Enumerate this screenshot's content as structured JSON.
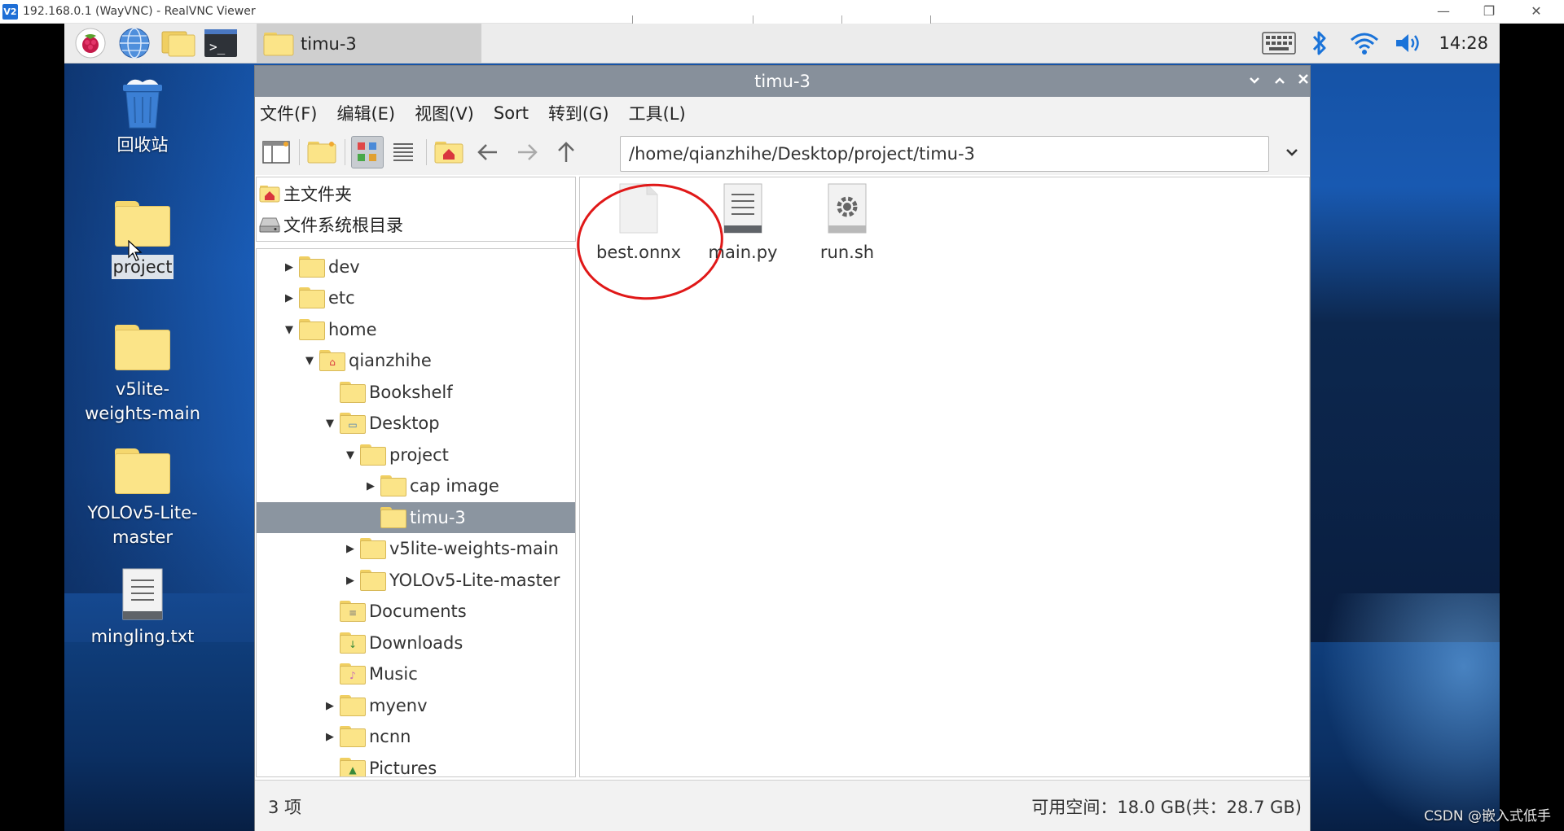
{
  "vnc": {
    "title": "192.168.0.1 (WayVNC) - RealVNC Viewer",
    "logo": "V2",
    "controls": {
      "minimize": "—",
      "restore": "❐",
      "close": "✕"
    }
  },
  "taskbar": {
    "launchers": [
      "raspberry-icon",
      "browser-globe-icon",
      "file-manager-icon",
      "terminal-icon"
    ],
    "task_label": "timu-3",
    "clock": "14:28"
  },
  "desktop": {
    "icons": [
      {
        "label": "回收站"
      },
      {
        "label": "project"
      },
      {
        "label": "v5lite-weights-main"
      },
      {
        "label": "YOLOv5-Lite-master"
      },
      {
        "label": "mingling.txt"
      }
    ]
  },
  "file_manager": {
    "title": "timu-3",
    "menu": [
      "文件(F)",
      "编辑(E)",
      "视图(V)",
      "Sort",
      "转到(G)",
      "工具(L)"
    ],
    "path": "/home/qianzhihe/Desktop/project/timu-3",
    "places": [
      "主文件夹",
      "文件系统根目录"
    ],
    "tree": [
      {
        "label": "dev"
      },
      {
        "label": "etc"
      },
      {
        "label": "home"
      },
      {
        "label": "qianzhihe"
      },
      {
        "label": "Bookshelf"
      },
      {
        "label": "Desktop"
      },
      {
        "label": "project"
      },
      {
        "label": "cap image"
      },
      {
        "label": "timu-3"
      },
      {
        "label": "v5lite-weights-main"
      },
      {
        "label": "YOLOv5-Lite-master"
      },
      {
        "label": "Documents"
      },
      {
        "label": "Downloads"
      },
      {
        "label": "Music"
      },
      {
        "label": "myenv"
      },
      {
        "label": "ncnn"
      },
      {
        "label": "Pictures"
      }
    ],
    "files": [
      {
        "name": "best.onnx",
        "icon": "blank-file-icon"
      },
      {
        "name": "main.py",
        "icon": "text-file-icon"
      },
      {
        "name": "run.sh",
        "icon": "script-gear-icon"
      }
    ],
    "status_left": "3 项",
    "status_right": "可用空间：18.0 GB(共：28.7 GB)"
  },
  "watermark": "CSDN @嵌入式低手",
  "colors": {
    "highlight": "#8b95a0",
    "titlebar": "#87909b",
    "annotation": "#e01818"
  }
}
